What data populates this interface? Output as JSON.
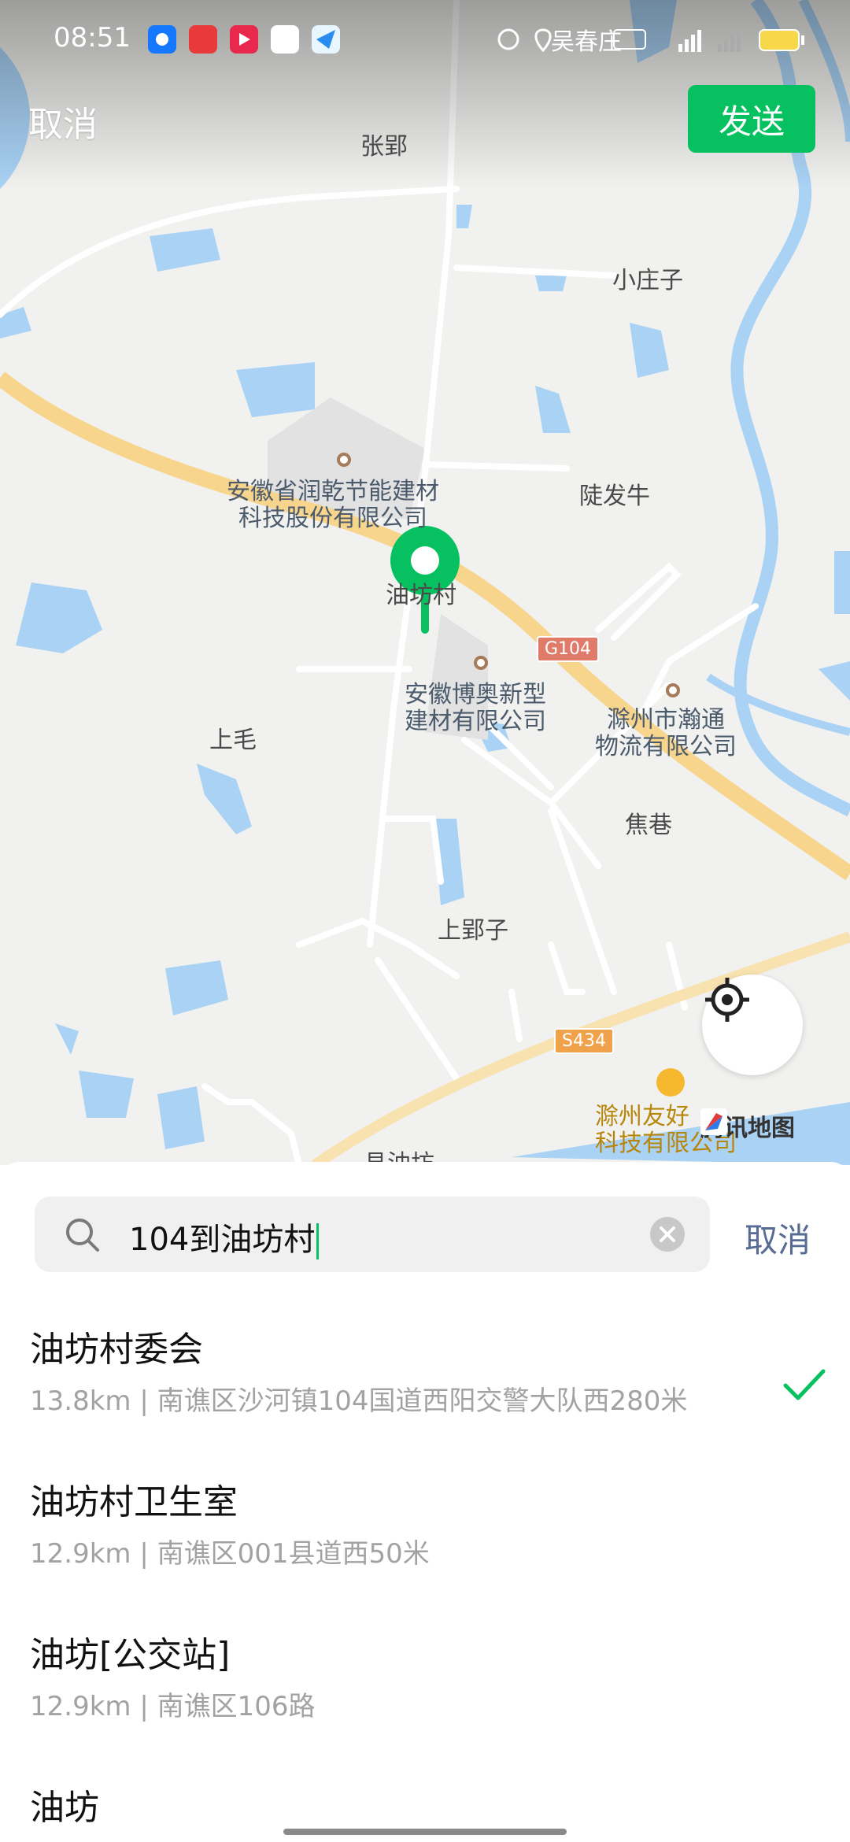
{
  "status_bar": {
    "time": "08:51",
    "carrier": "吴春庄"
  },
  "header": {
    "cancel_label": "取消",
    "send_label": "发送"
  },
  "map": {
    "labels": {
      "zhangying": "张郢",
      "xiaozhuangzi": "小庄子",
      "runqian": "安徽省润乾节能建材\n科技股份有限公司",
      "lufaniu": "陡发牛",
      "youfangcun": "油坊村",
      "boao": "安徽博奥新型\n建材有限公司",
      "shangmao": "上毛",
      "hantong": "滁州市瀚通\n物流有限公司",
      "jiaoxiang": "焦巷",
      "shangyingzi": "上郢子",
      "youhao": "滁州友好\n科技有限公司",
      "bottom_partial": "县油坊"
    },
    "road_badges": {
      "g104": "G104",
      "s434": "S434"
    },
    "attribution": "腾讯地图"
  },
  "search": {
    "value": "104到油坊村",
    "cancel_label": "取消"
  },
  "results": [
    {
      "name": "油坊村委会",
      "address": "13.8km | 南谯区沙河镇104国道西阳交警大队西280米",
      "selected": true
    },
    {
      "name": "油坊村卫生室",
      "address": "12.9km | 南谯区001县道西50米",
      "selected": false
    },
    {
      "name": "油坊[公交站]",
      "address": "12.9km | 南谯区106路",
      "selected": false
    },
    {
      "name": "油坊",
      "address": "",
      "selected": false
    }
  ],
  "colors": {
    "accent": "#07c160",
    "link": "#576b95",
    "road_major": "#f7d58c",
    "water": "#a9d2f5"
  }
}
